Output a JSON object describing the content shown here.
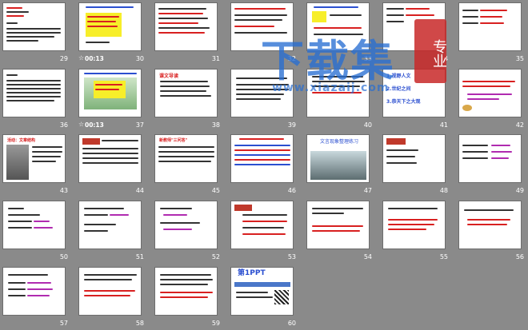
{
  "slides": [
    {
      "n": "29"
    },
    {
      "n": "30",
      "time": "00:13"
    },
    {
      "n": "31"
    },
    {
      "n": "32"
    },
    {
      "n": "33"
    },
    {
      "n": "34"
    },
    {
      "n": "35"
    },
    {
      "n": "36"
    },
    {
      "n": "37",
      "time": "00:13"
    },
    {
      "n": "38"
    },
    {
      "n": "39"
    },
    {
      "n": "40"
    },
    {
      "n": "41"
    },
    {
      "n": "42"
    },
    {
      "n": "43"
    },
    {
      "n": "44"
    },
    {
      "n": "45"
    },
    {
      "n": "46"
    },
    {
      "n": "47"
    },
    {
      "n": "48"
    },
    {
      "n": "49"
    },
    {
      "n": "50"
    },
    {
      "n": "51"
    },
    {
      "n": "52"
    },
    {
      "n": "53"
    },
    {
      "n": "54"
    },
    {
      "n": "55"
    },
    {
      "n": "56"
    },
    {
      "n": "57"
    },
    {
      "n": "58"
    },
    {
      "n": "59"
    },
    {
      "n": "60"
    }
  ],
  "watermark": {
    "text": "下载集",
    "url": "www.xiazaij.com",
    "seal": "专业"
  },
  "slide_texts": {
    "s34_title": "课文导读",
    "s41_line1": "1.视野人文",
    "s41_line2": "2.世纪之间",
    "s41_line3": "3.恭天下之大观",
    "s47_title": "文言现象整理练习",
    "s60_brand": "第1PPT",
    "s43_title": "活动：文章结构",
    "s45_title": "新教师\"三问答\""
  }
}
